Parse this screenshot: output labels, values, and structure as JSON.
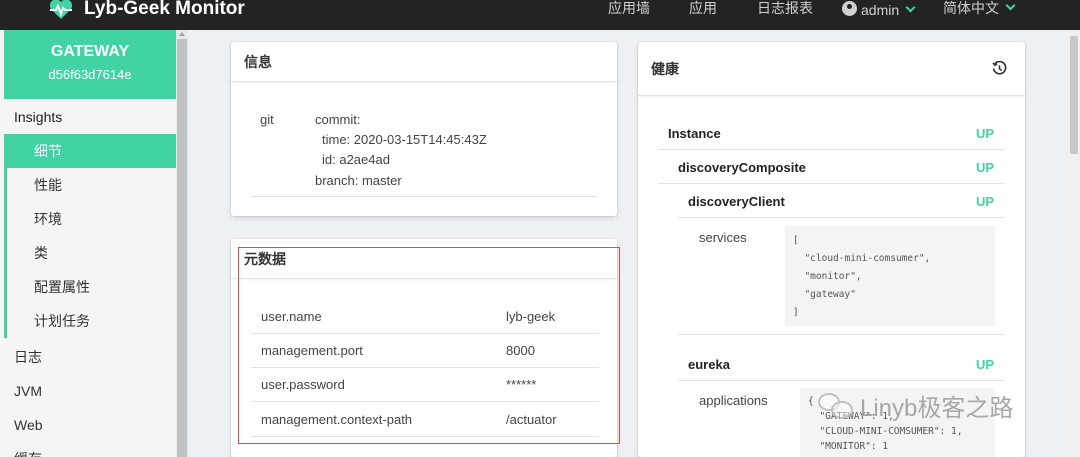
{
  "app": {
    "title": "Lyb-Geek Monitor"
  },
  "nav": {
    "wallboard": "应用墙",
    "applications": "应用",
    "journal": "日志报表",
    "user": "admin",
    "language": "简体中文"
  },
  "instance": {
    "name": "GATEWAY",
    "id": "d56f63d7614e"
  },
  "sidebar": {
    "insights_label": "Insights",
    "insights_items": [
      "细节",
      "性能",
      "环境",
      "类",
      "配置属性",
      "计划任务"
    ],
    "other_items": [
      "日志",
      "JVM",
      "Web",
      "缓存"
    ]
  },
  "info": {
    "title": "信息",
    "git_key": "git",
    "commit_label": "commit:",
    "time_label": "time: 2020-03-15T14:45:43Z",
    "id_label": "id: a2ae4ad",
    "branch_label": "branch: master"
  },
  "metadata": {
    "title": "元数据",
    "rows": [
      {
        "key": "user.name",
        "value": "lyb-geek"
      },
      {
        "key": "management.port",
        "value": "8000"
      },
      {
        "key": "user.password",
        "value": "******"
      },
      {
        "key": "management.context-path",
        "value": "/actuator"
      }
    ]
  },
  "health": {
    "title": "健康",
    "instance_label": "Instance",
    "instance_status": "UP",
    "composite_label": "discoveryComposite",
    "composite_status": "UP",
    "client_label": "discoveryClient",
    "client_status": "UP",
    "services_label": "services",
    "services_lines": [
      "[",
      "  \"cloud-mini-comsumer\",",
      "  \"monitor\",",
      "  \"gateway\"",
      "]"
    ],
    "eureka_label": "eureka",
    "eureka_status": "UP",
    "applications_label": "applications",
    "applications_lines": [
      "{",
      "  \"GATEWAY\": 1,",
      "  \"CLOUD-MINI-COMSUMER\": 1,",
      "  \"MONITOR\": 1"
    ]
  },
  "watermark": {
    "text": "Linyb极客之路"
  },
  "colors": {
    "accent": "#42d3a5",
    "topbar": "#232323",
    "highlight": "#e04a4a"
  }
}
